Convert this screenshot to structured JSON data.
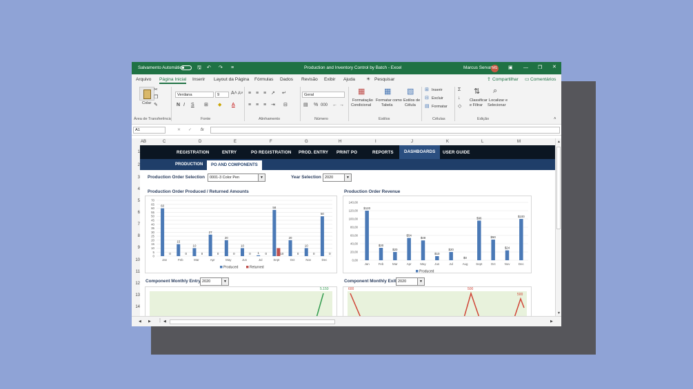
{
  "titlebar": {
    "autosave_label": "Salvamento Automático",
    "document_title": "Production and Inventory Control by Batch  -  Excel",
    "user_name": "Marcus Servatti",
    "user_initials": "MS"
  },
  "menu": {
    "items": [
      "Arquivo",
      "Página Inicial",
      "Inserir",
      "Layout da Página",
      "Fórmulas",
      "Dados",
      "Revisão",
      "Exibir",
      "Ajuda"
    ],
    "active": "Página Inicial",
    "search_label": "Pesquisar",
    "share_label": "Compartilhar",
    "comments_label": "Comentários"
  },
  "ribbon": {
    "paste_label": "Colar",
    "font_name": "Verdana",
    "font_size": "9",
    "number_format": "Geral",
    "cond_format": [
      "Formatação",
      "Condicional"
    ],
    "format_table": [
      "Formatar como",
      "Tabela"
    ],
    "cell_styles": [
      "Estilos de",
      "Célula"
    ],
    "insert": "Inserir",
    "delete": "Excluir",
    "format": "Formatar",
    "sort_filter": [
      "Classificar",
      "e Filtrar"
    ],
    "find_select": [
      "Localizar e",
      "Selecionar"
    ],
    "groups": [
      "Área de Transferência",
      "Fonte",
      "Alinhamento",
      "Número",
      "Estilos",
      "Células",
      "Edição"
    ]
  },
  "formula": {
    "name_box": "A1",
    "fx": "fx"
  },
  "columns": [
    "A",
    "B",
    "C",
    "D",
    "E",
    "F",
    "G",
    "H",
    "I",
    "J",
    "K",
    "L",
    "M"
  ],
  "rows": [
    "1",
    "2",
    "3",
    "4",
    "5",
    "6",
    "7",
    "8",
    "9",
    "10",
    "11",
    "12",
    "13",
    "14"
  ],
  "nav": {
    "tabs": [
      "REGISTRATION",
      "ENTRY",
      "PO REGISTRATION",
      "PROD. ENTRY",
      "PRINT PO",
      "REPORTS",
      "DASHBOARDS",
      "USER GUIDE"
    ],
    "active": "DASHBOARDS",
    "subtabs": [
      "PRODUCTION",
      "PO AND COMPONENTS"
    ],
    "active_sub": "PO AND COMPONENTS"
  },
  "filters": {
    "po_label": "Production Order Selection",
    "po_value": "0001-3 Color Pen",
    "year_label": "Year Selection",
    "year_value": "2020"
  },
  "colors": {
    "excel_green": "#1f7244",
    "produced": "#4a79b6",
    "returned": "#c0504d",
    "entry_line": "#2f9a4c",
    "exit_line": "#d04436"
  },
  "chart_data": [
    {
      "type": "bar",
      "title": "Production Order Produced / Returned Amounts",
      "categories": [
        "Jan",
        "Feb",
        "Mar",
        "Apr",
        "May",
        "Jun",
        "Jul",
        "Sept",
        "Oct",
        "Nov",
        "Dec"
      ],
      "series": [
        {
          "name": "Produced",
          "values": [
            60,
            15,
            10,
            27,
            20,
            10,
            1,
            58,
            20,
            10,
            50
          ]
        },
        {
          "name": "Returned",
          "values": [
            0,
            0,
            0,
            0,
            0,
            0,
            0,
            10,
            0,
            0,
            0
          ]
        }
      ],
      "yticks": [
        "0",
        "5",
        "10",
        "15",
        "20",
        "25",
        "30",
        "35",
        "40",
        "45",
        "50",
        "55",
        "60",
        "65",
        "70"
      ],
      "ylim": [
        0,
        70
      ],
      "legend": "bottom"
    },
    {
      "type": "bar",
      "title": "Production Order Revenue",
      "categories": [
        "Jan",
        "Feb",
        "Mar",
        "Apr",
        "May",
        "Jun",
        "Jul",
        "Aug",
        "Sept",
        "Oct",
        "Nov",
        "Dec"
      ],
      "series": [
        {
          "name": "Produced",
          "values": [
            120,
            30,
            20,
            54,
            48,
            10,
            20,
            0,
            96,
            50,
            24,
            100
          ]
        }
      ],
      "labels": [
        "$120",
        "$30",
        "$20",
        "$54",
        "$48",
        "$10",
        "$20",
        "$0",
        "$96",
        "$50",
        "$24",
        "$100"
      ],
      "yticks": [
        "0,00",
        "20,00",
        "40,00",
        "60,00",
        "80,00",
        "100,00",
        "120,00",
        "140,00"
      ],
      "ylim": [
        0,
        140
      ],
      "legend": "bottom"
    },
    {
      "type": "line",
      "title": "Component Monthly Entry",
      "year_value": "2020",
      "peak_label": "5.150"
    },
    {
      "type": "line",
      "title": "Component Monthly Exit",
      "year_value": "2020",
      "point_labels": [
        "600",
        "500",
        "500"
      ]
    }
  ]
}
